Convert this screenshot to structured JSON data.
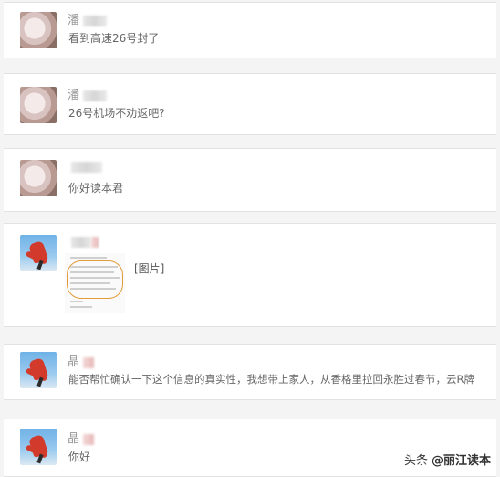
{
  "messages": [
    {
      "name": "潘",
      "text": "看到高速26号封了",
      "avatar": "pink"
    },
    {
      "name": "潘",
      "text": "26号机场不劝返吧?",
      "avatar": "pink"
    },
    {
      "name": "",
      "text": "你好读本君",
      "avatar": "pink"
    },
    {
      "name": "",
      "text": "[图片]",
      "avatar": "sky",
      "is_image": true
    },
    {
      "name": "晶",
      "text": "能否帮忙确认一下这个信息的真实性，我想带上家人，从香格里拉回永胜过春节，云R牌",
      "avatar": "sky"
    },
    {
      "name": "晶",
      "text": "你好",
      "avatar": "sky"
    }
  ],
  "watermark": {
    "prefix": "头条",
    "handle": "@丽江读本"
  }
}
